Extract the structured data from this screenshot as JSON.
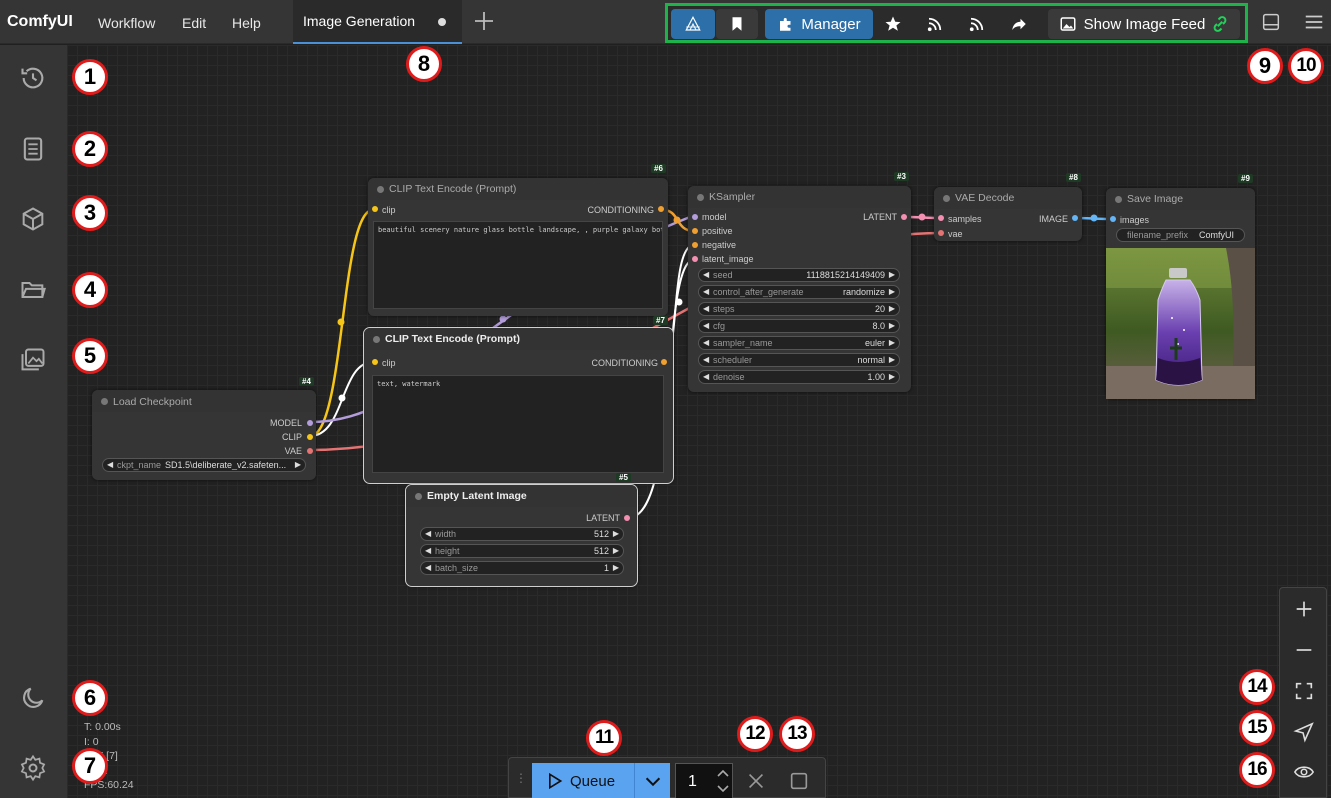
{
  "app": {
    "name": "ComfyUI"
  },
  "menu": {
    "workflow": "Workflow",
    "edit": "Edit",
    "help": "Help"
  },
  "tabs": [
    {
      "label": "Image Generation",
      "unsaved": true
    }
  ],
  "toolbar": {
    "manager_label": "Manager",
    "image_feed_label": "Show Image Feed"
  },
  "stats": {
    "line1": "T: 0.00s",
    "line2": "I: 0",
    "line3": "N: 7 [7]",
    "line4": "V: 11",
    "line5": "FPS:60.24"
  },
  "nodes": {
    "clip_pos": {
      "title": "CLIP Text Encode (Prompt)",
      "id": "#6",
      "input": "clip",
      "output": "CONDITIONING",
      "text": "beautiful scenery nature glass bottle landscape, , purple galaxy bottle,"
    },
    "clip_neg": {
      "title": "CLIP Text Encode (Prompt)",
      "id": "#7",
      "input": "clip",
      "output": "CONDITIONING",
      "text": "text, watermark"
    },
    "ksampler": {
      "title": "KSampler",
      "id": "#3",
      "inputs": [
        "model",
        "positive",
        "negative",
        "latent_image"
      ],
      "output": "LATENT",
      "widgets": [
        {
          "name": "seed",
          "value": "1118815214149409"
        },
        {
          "name": "control_after_generate",
          "value": "randomize"
        },
        {
          "name": "steps",
          "value": "20"
        },
        {
          "name": "cfg",
          "value": "8.0"
        },
        {
          "name": "sampler_name",
          "value": "euler"
        },
        {
          "name": "scheduler",
          "value": "normal"
        },
        {
          "name": "denoise",
          "value": "1.00"
        }
      ]
    },
    "vae_decode": {
      "title": "VAE Decode",
      "id": "#8",
      "inputs": [
        "samples",
        "vae"
      ],
      "output": "IMAGE"
    },
    "save_image": {
      "title": "Save Image",
      "id": "#9",
      "input": "images",
      "widget_name": "filename_prefix",
      "widget_value": "ComfyUI"
    },
    "load_ckpt": {
      "title": "Load Checkpoint",
      "id": "#4",
      "outputs": [
        "MODEL",
        "CLIP",
        "VAE"
      ],
      "widget_name": "ckpt_name",
      "widget_value": "SD1.5\\deliberate_v2.safeten..."
    },
    "empty_latent": {
      "title": "Empty Latent Image",
      "id": "#5",
      "output": "LATENT",
      "widgets": [
        {
          "name": "width",
          "value": "512"
        },
        {
          "name": "height",
          "value": "512"
        },
        {
          "name": "batch_size",
          "value": "1"
        }
      ]
    }
  },
  "queue": {
    "label": "Queue",
    "count": "1"
  },
  "callouts": [
    "1",
    "2",
    "3",
    "4",
    "5",
    "6",
    "7",
    "8",
    "9",
    "10",
    "11",
    "12",
    "13",
    "14",
    "15",
    "16"
  ],
  "colors": {
    "accent": "#5aa3f0",
    "toolbar_border": "#1fb24a",
    "callout_border": "#e01b1b",
    "manager_bg": "#2d6fa8"
  },
  "icons": {
    "sidebar": [
      "history-icon",
      "book-icon",
      "cube-icon",
      "folder-icon",
      "images-icon",
      "moon-icon",
      "gear-icon"
    ],
    "toolbar": [
      "comfy-logo-icon",
      "bookmark-icon",
      "puzzle-icon",
      "star-icon",
      "share-icon",
      "share-icon",
      "forward-icon",
      "image-icon",
      "link-icon"
    ],
    "zoom": [
      "plus-icon",
      "minus-icon",
      "fit-view-icon",
      "navigate-icon",
      "eye-icon"
    ]
  }
}
